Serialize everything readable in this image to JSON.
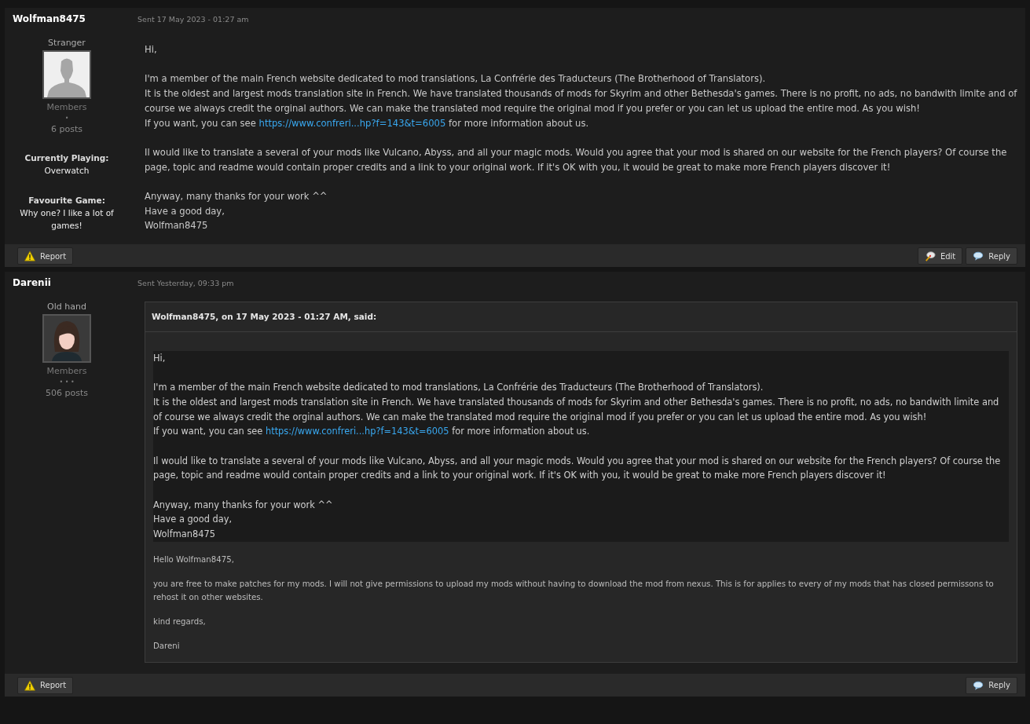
{
  "posts": [
    {
      "author": "Wolfman8475",
      "sent": "Sent 17 May 2023 - 01:27 am",
      "rank": "Stranger",
      "avatar": {
        "kind": "silhouette"
      },
      "group": "Members",
      "pips": "•",
      "post_count": "6 posts",
      "profile_fields": [
        {
          "label": "Currently Playing:",
          "value": "Overwatch"
        },
        {
          "label": "Favourite Game:",
          "value": "Why one? I like a lot of games!"
        }
      ],
      "body": [
        [
          [
            {
              "text": "Hi,"
            }
          ]
        ],
        [
          [
            {
              "text": "I'm a member of the main French website dedicated to mod translations, La Confrérie des Traducteurs (The Brotherhood of Translators)."
            }
          ],
          [
            {
              "text": "It is the oldest and largest mods translation site in French. We have translated thousands of mods for Skyrim and other Bethesda's games. There is no profit, no ads, no bandwith limite and of course we always credit the orginal authors. We can make the translated mod require the original mod if you prefer or you can let us upload the entire mod. As you wish!"
            }
          ],
          [
            {
              "text": "If you want, you can see "
            },
            {
              "link": "https://www.confreri...hp?f=143&t=6005"
            },
            {
              "text": " for more information about us."
            }
          ]
        ],
        [
          [
            {
              "text": "Il would like to translate a several of your mods like Vulcano, Abyss, and all your magic mods. Would you agree that your mod is shared on our website for the French players? Of course the page, topic and readme would contain proper credits and a link to your original work. If it's OK with you, it would be great to make more French players discover it!"
            }
          ]
        ],
        [
          [
            {
              "text": "Anyway, many thanks for your work ^^"
            }
          ],
          [
            {
              "text": "Have a good day,"
            }
          ],
          [
            {
              "text": "Wolfman8475"
            }
          ]
        ]
      ],
      "buttons_left": [
        {
          "kind": "report",
          "label": "Report"
        }
      ],
      "buttons_right": [
        {
          "kind": "edit",
          "label": "Edit"
        },
        {
          "kind": "reply",
          "label": "Reply"
        }
      ]
    },
    {
      "author": "Darenii",
      "sent": "Sent Yesterday, 09:33 pm",
      "rank": "Old hand",
      "avatar": {
        "kind": "portrait"
      },
      "group": "Members",
      "pips": "• • •",
      "post_count": "506 posts",
      "quote": {
        "header": "Wolfman8475, on 17 May 2023 - 01:27 AM, said:",
        "body": [
          [
            [
              {
                "text": "Hi,"
              }
            ]
          ],
          [
            [
              {
                "text": "I'm a member of the main French website dedicated to mod translations, La Confrérie des Traducteurs (The Brotherhood of Translators)."
              }
            ],
            [
              {
                "text": "It is the oldest and largest mods translation site in French. We have translated thousands of mods for Skyrim and other Bethesda's games. There is no profit, no ads, no bandwith limite and of course we always credit the orginal authors. We can make the translated mod require the original mod if you prefer or you can let us upload the entire mod. As you wish!"
              }
            ],
            [
              {
                "text": "If you want, you can see "
              },
              {
                "link": "https://www.confreri...hp?f=143&t=6005"
              },
              {
                "text": " for more information about us."
              }
            ]
          ],
          [
            [
              {
                "text": "Il would like to translate a several of your mods like Vulcano, Abyss, and all your magic mods. Would you agree that your mod is shared on our website for the French players? Of course the page, topic and readme would contain proper credits and a link to your original work. If it's OK with you, it would be great to make more French players discover it!"
              }
            ]
          ],
          [
            [
              {
                "text": "Anyway, many thanks for your work ^^"
              }
            ],
            [
              {
                "text": "Have a good day,"
              }
            ],
            [
              {
                "text": "Wolfman8475"
              }
            ]
          ]
        ],
        "reply": [
          [
            "Hello Wolfman8475,"
          ],
          [
            "you are free to make patches for my mods. I will not give permissions to upload my mods without having to download the mod from nexus. This is for applies to every of my mods that has closed permissons to rehost it on other websites."
          ],
          [
            "kind regards,"
          ],
          [
            "Dareni"
          ]
        ]
      },
      "buttons_left": [
        {
          "kind": "report",
          "label": "Report"
        }
      ],
      "buttons_right": [
        {
          "kind": "reply",
          "label": "Reply"
        }
      ]
    }
  ]
}
